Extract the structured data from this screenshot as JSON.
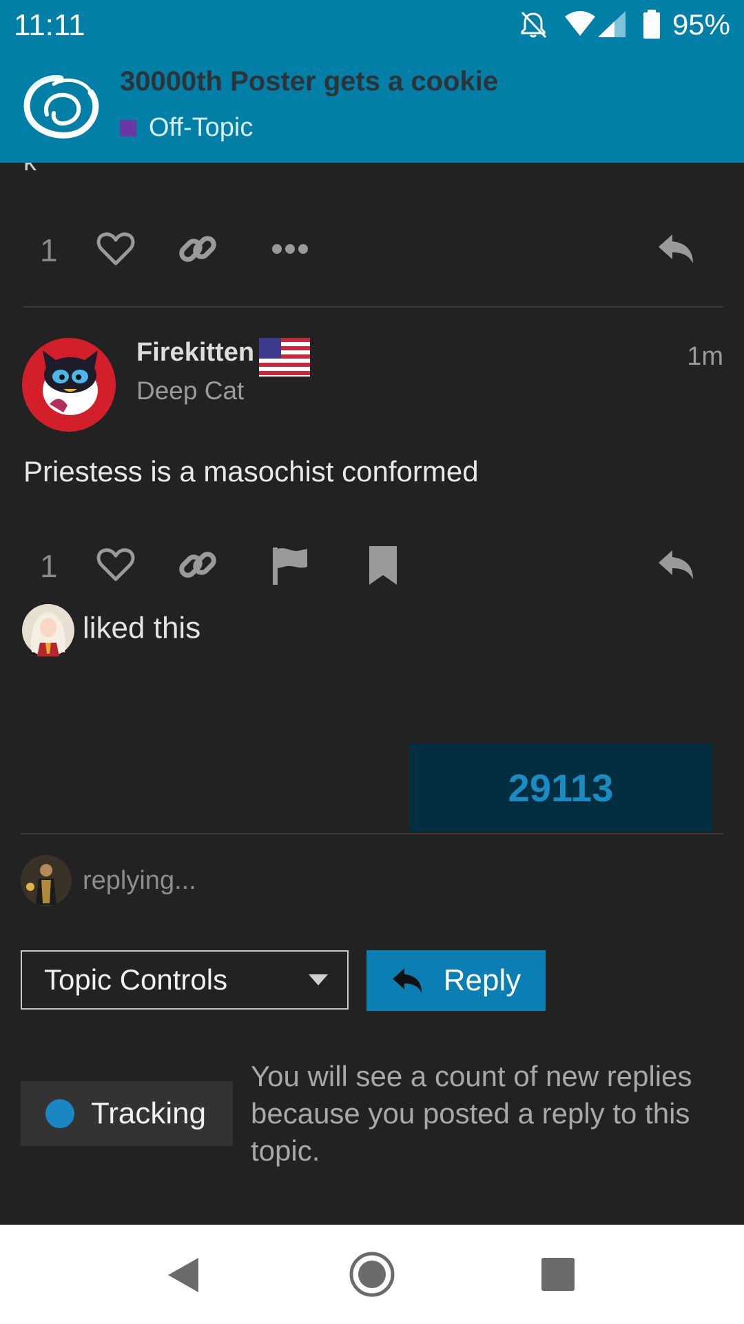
{
  "status_bar": {
    "time": "11:11",
    "battery_percent": "95%",
    "icons": [
      "notifications-off-icon",
      "wifi-icon",
      "signal-icon",
      "battery-icon"
    ]
  },
  "header": {
    "title": "30000th Poster gets a cookie",
    "category": "Off-Topic",
    "category_color": "#6b36a6",
    "background": "#017fa6"
  },
  "previous_post": {
    "stray_text": "k",
    "like_count": "1",
    "actions": [
      "like-icon",
      "link-icon",
      "more-icon",
      "reply-icon"
    ]
  },
  "post": {
    "username": "Firekitten",
    "user_title": "Deep Cat",
    "time": "1m",
    "body": "Priestess is a masochist conformed",
    "like_count": "1",
    "actions": [
      "like-icon",
      "link-icon",
      "flag-icon",
      "bookmark-icon",
      "reply-icon"
    ],
    "liked_by_text": "liked this"
  },
  "timeline": {
    "post_number": "29113"
  },
  "composer": {
    "replying_text": "replying..."
  },
  "controls": {
    "topic_controls_label": "Topic Controls",
    "reply_label": "Reply"
  },
  "notification": {
    "level_label": "Tracking",
    "description": "You will see a count of new replies because you posted a reply to this topic."
  },
  "colors": {
    "accent": "#0b7fb3",
    "background": "#222222"
  }
}
